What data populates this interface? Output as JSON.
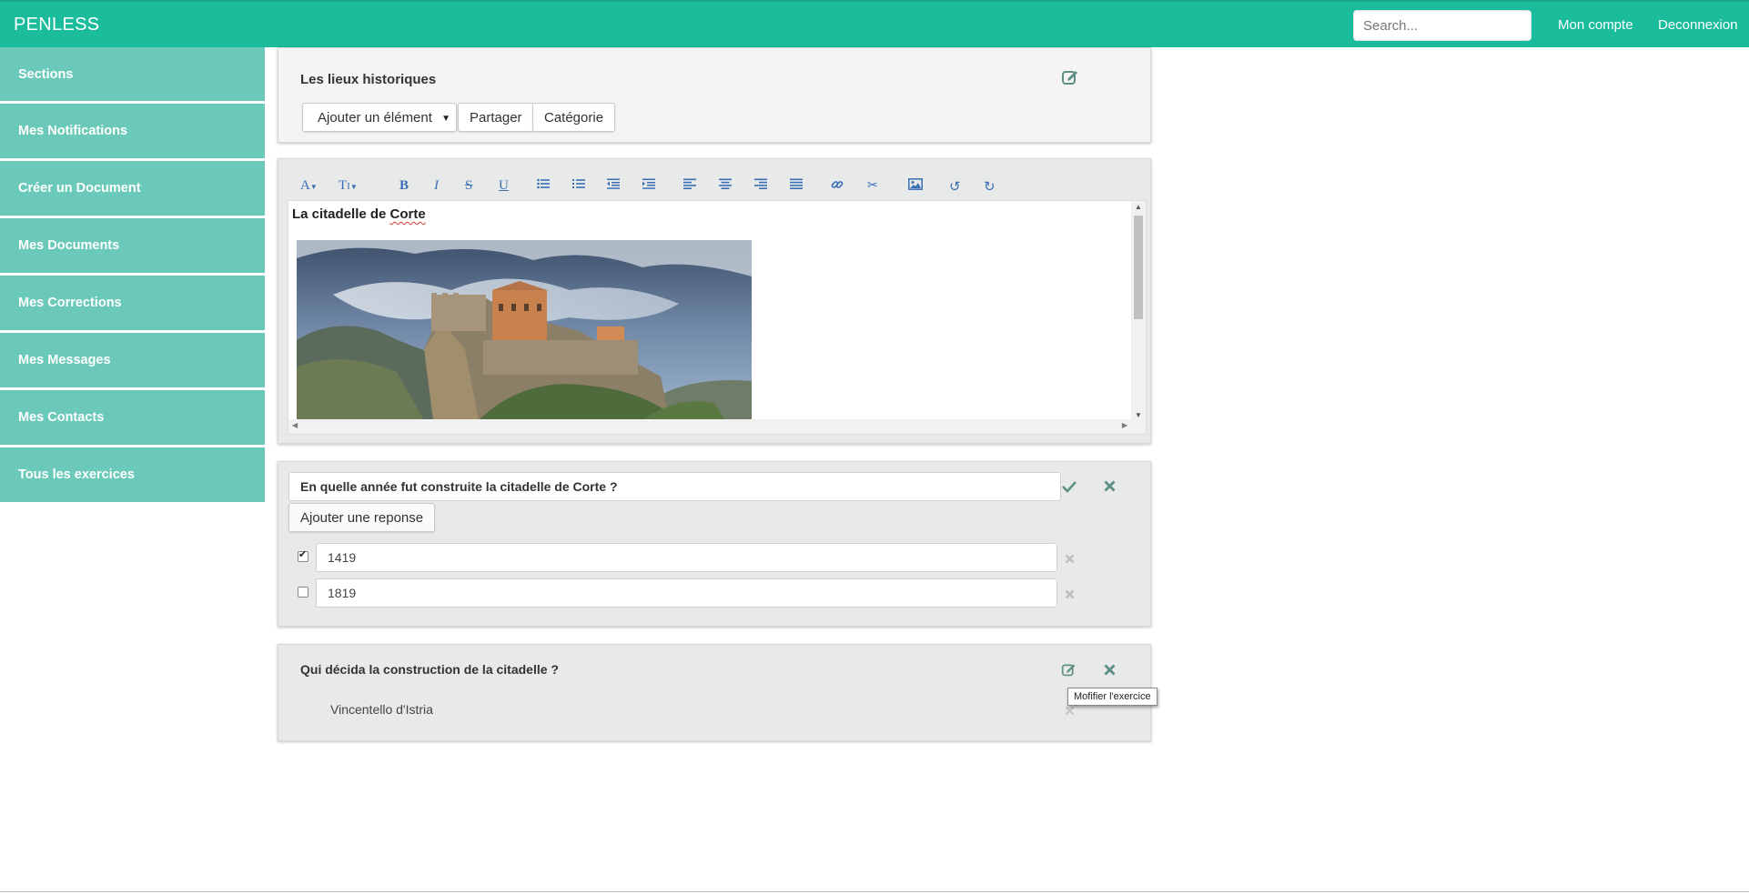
{
  "navbar": {
    "brand": "PENLESS",
    "search_placeholder": "Search...",
    "links": [
      "Mon compte",
      "Deconnexion"
    ],
    "color": "#1abc9c"
  },
  "sidebar": {
    "color": "#6ac9b8",
    "items": [
      {
        "label": "Sections"
      },
      {
        "label": "Mes Notifications"
      },
      {
        "label": "Créer un Document"
      },
      {
        "label": "Mes Documents"
      },
      {
        "label": "Mes Corrections"
      },
      {
        "label": "Mes Messages"
      },
      {
        "label": "Mes Contacts"
      },
      {
        "label": "Tous les exercices"
      }
    ]
  },
  "section": {
    "title": "Les lieux historiques",
    "edit_icon": "edit-square-icon",
    "add_element_select": "Ajouter un élément",
    "share_button": "Partager",
    "category_button": "Catégorie"
  },
  "editor": {
    "toolbar": [
      {
        "icon": "font-family-icon",
        "glyph": "A▾"
      },
      {
        "icon": "font-size-icon",
        "glyph": "T▾"
      },
      {
        "icon": "bold-icon",
        "glyph": "B"
      },
      {
        "icon": "italic-icon",
        "glyph": "I"
      },
      {
        "icon": "strikethrough-icon",
        "glyph": "S"
      },
      {
        "icon": "underline-icon",
        "glyph": "U"
      },
      {
        "icon": "bullet-list-icon",
        "glyph": "☰"
      },
      {
        "icon": "numbered-list-icon",
        "glyph": "☰"
      },
      {
        "icon": "outdent-icon",
        "glyph": "☰"
      },
      {
        "icon": "indent-icon",
        "glyph": "☰"
      },
      {
        "icon": "align-left-icon",
        "glyph": "≡"
      },
      {
        "icon": "align-center-icon",
        "glyph": "≡"
      },
      {
        "icon": "align-right-icon",
        "glyph": "≡"
      },
      {
        "icon": "align-justify-icon",
        "glyph": "≡"
      },
      {
        "icon": "link-icon",
        "glyph": "∞"
      },
      {
        "icon": "cut-icon",
        "glyph": "✂"
      },
      {
        "icon": "image-icon",
        "glyph": "▣"
      },
      {
        "icon": "undo-icon",
        "glyph": "↺"
      },
      {
        "icon": "redo-icon",
        "glyph": "↻"
      }
    ],
    "doc_title_part1": "La citadelle de ",
    "doc_title_part2": "Corte",
    "image_subject": "citadel-photo"
  },
  "question1": {
    "question": "En quelle année fut construite la citadelle de Corte ?",
    "add_answer_button": "Ajouter une reponse",
    "answers": [
      {
        "value": "1419",
        "checked": true
      },
      {
        "value": "1819",
        "checked": false
      }
    ]
  },
  "question2": {
    "question": "Qui décida la construction de la citadelle ?",
    "answer": "Vincentello d'Istria",
    "tooltip": "Mofifier l'exercice"
  }
}
